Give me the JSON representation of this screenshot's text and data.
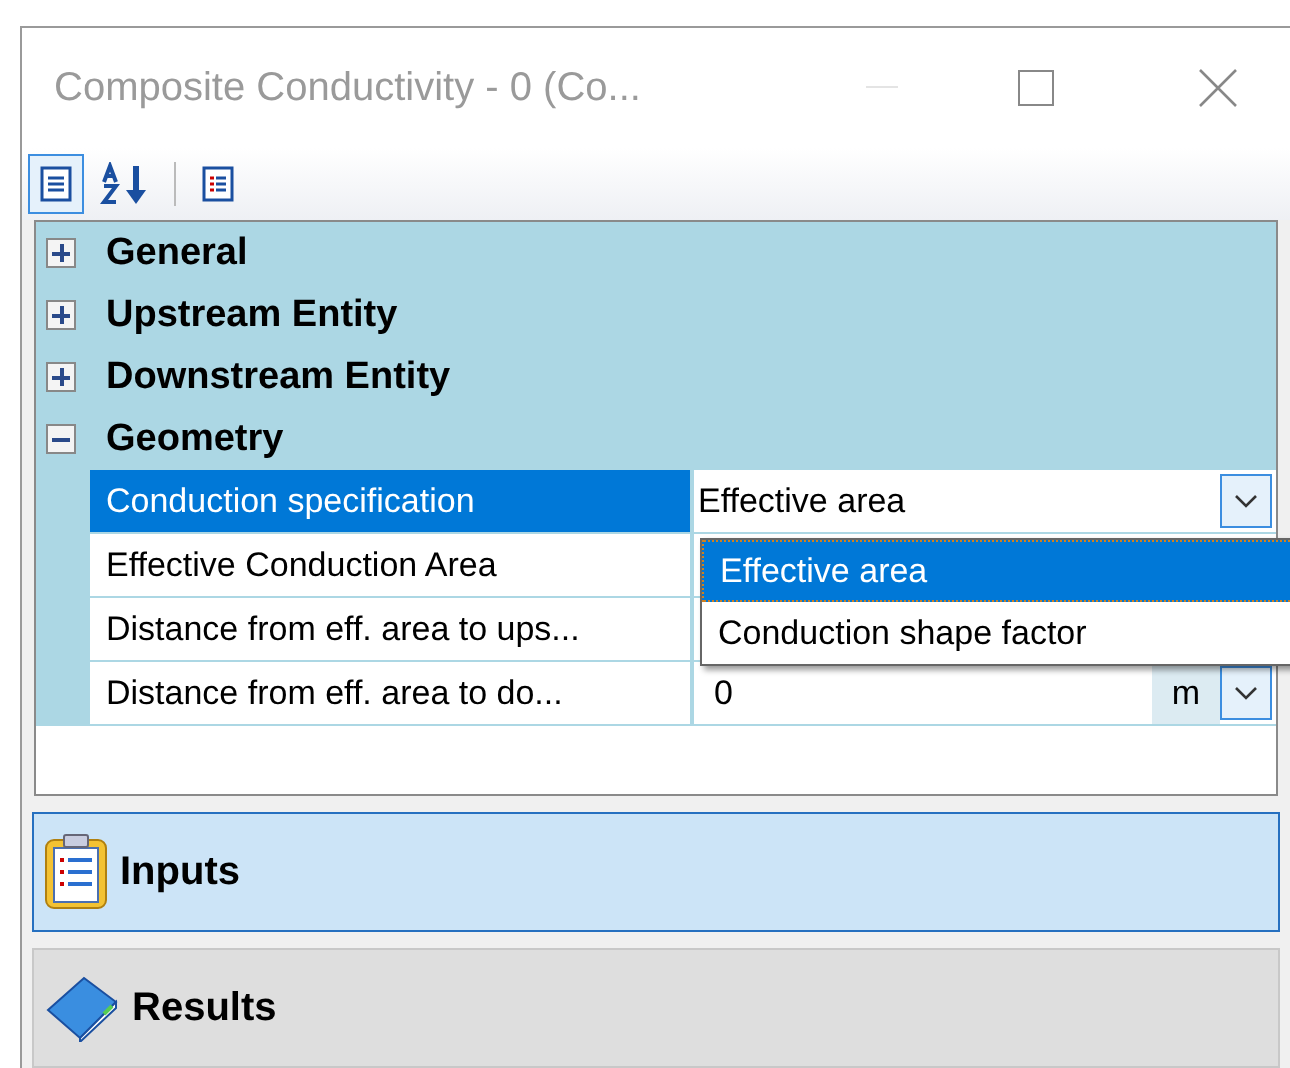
{
  "window": {
    "title": "Composite Conductivity - 0 (Co..."
  },
  "toolbar": [
    {
      "kind": "categorized",
      "selected": true
    },
    {
      "kind": "alphabetical",
      "selected": false
    },
    {
      "kind": "pages",
      "selected": false
    }
  ],
  "categories": [
    {
      "label": "General",
      "expanded": false
    },
    {
      "label": "Upstream Entity",
      "expanded": false
    },
    {
      "label": "Downstream Entity",
      "expanded": false
    },
    {
      "label": "Geometry",
      "expanded": true,
      "properties": [
        {
          "label": "Conduction specification",
          "selected": true,
          "value": "Effective area",
          "kind": "dropdown"
        },
        {
          "label": "Effective Conduction Area",
          "selected": false,
          "kind": "hidden"
        },
        {
          "label": "Distance from eff. area to ups...",
          "selected": false,
          "kind": "hidden"
        },
        {
          "label": "Distance from eff. area to do...",
          "selected": false,
          "value": "0",
          "unit": "m",
          "kind": "unit"
        }
      ]
    }
  ],
  "dropdown_list": [
    {
      "label": "Effective area",
      "selected": true
    },
    {
      "label": "Conduction shape factor",
      "selected": false
    }
  ],
  "panes": [
    {
      "label": "Inputs",
      "kind": "inputs",
      "selected": true
    },
    {
      "label": "Results",
      "kind": "results",
      "selected": false
    }
  ]
}
